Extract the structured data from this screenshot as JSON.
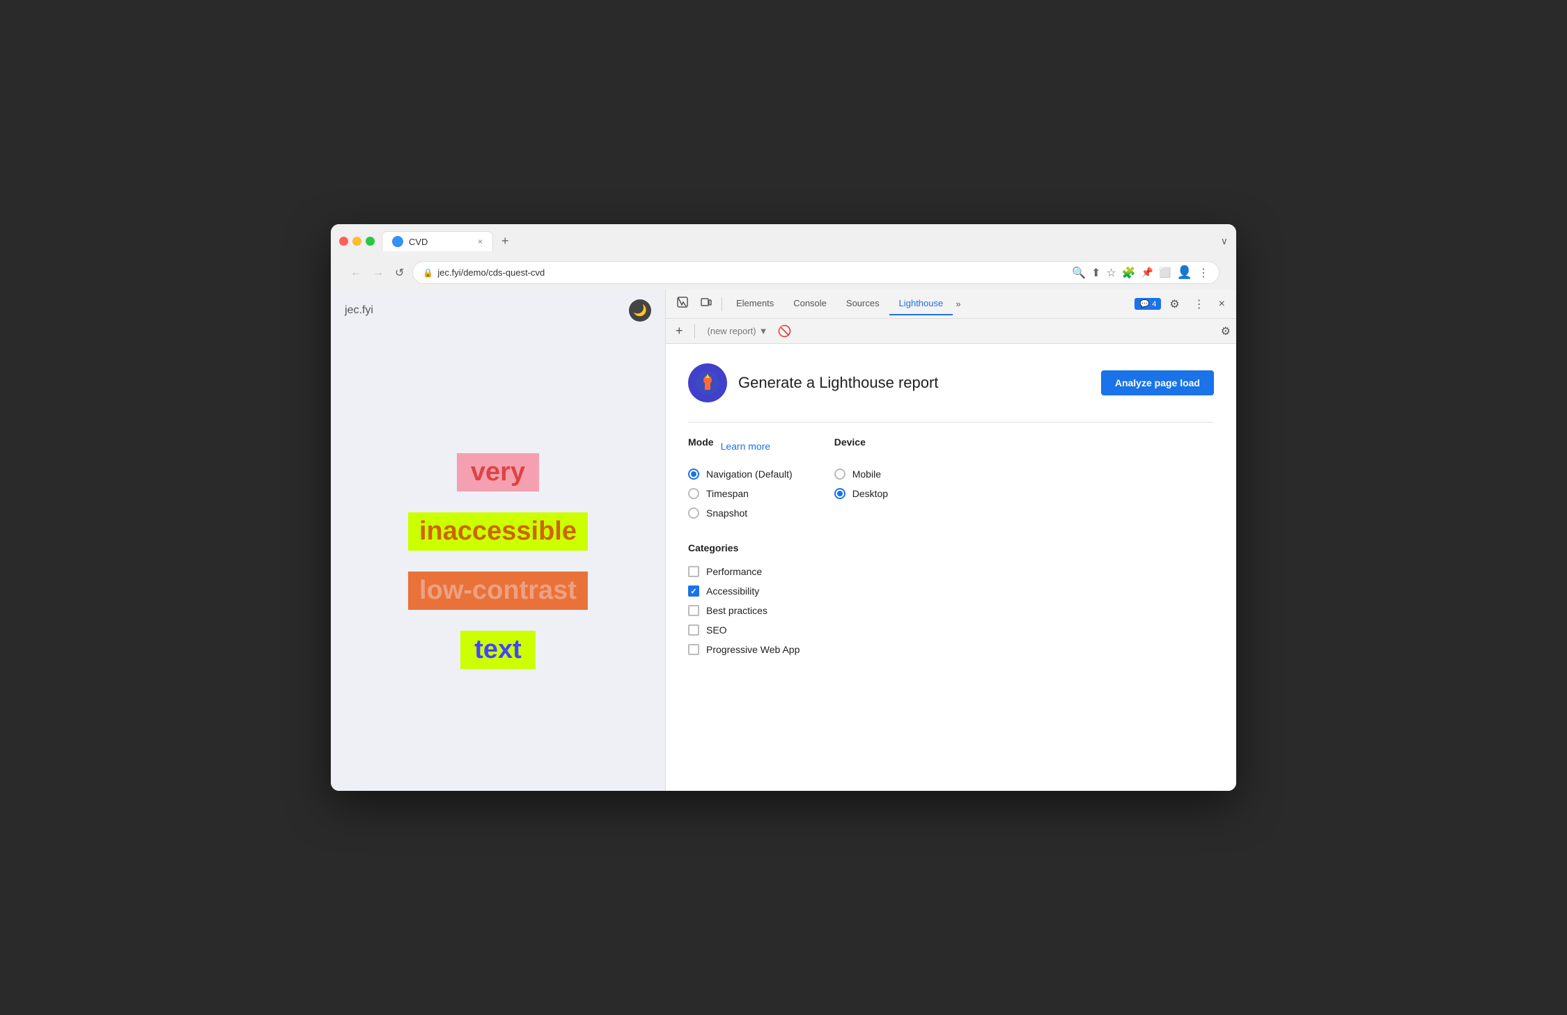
{
  "browser": {
    "tab_label": "CVD",
    "tab_close": "×",
    "tab_new": "+",
    "tab_more": "∨",
    "url": "jec.fyi/demo/cds-quest-cvd",
    "nav_back": "←",
    "nav_forward": "→",
    "nav_refresh": "↺"
  },
  "webpage": {
    "logo": "jec.fyi",
    "dark_mode_icon": "🌙",
    "words": [
      {
        "text": "very",
        "class": "text-very"
      },
      {
        "text": "inaccessible",
        "class": "text-inaccessible"
      },
      {
        "text": "low-contrast",
        "class": "text-lowcontrast"
      },
      {
        "text": "text",
        "class": "text-text"
      }
    ]
  },
  "devtools": {
    "tabs": [
      {
        "label": "Elements",
        "active": false
      },
      {
        "label": "Console",
        "active": false
      },
      {
        "label": "Sources",
        "active": false
      },
      {
        "label": "Lighthouse",
        "active": true
      }
    ],
    "more_tabs": "»",
    "badge_count": "4",
    "new_report_placeholder": "(new report)",
    "analyze_button": "Analyze page load",
    "generate_title": "Generate a Lighthouse report",
    "mode_label": "Mode",
    "learn_more": "Learn more",
    "device_label": "Device",
    "mode_options": [
      {
        "label": "Navigation (Default)",
        "selected": true
      },
      {
        "label": "Timespan",
        "selected": false
      },
      {
        "label": "Snapshot",
        "selected": false
      }
    ],
    "device_options": [
      {
        "label": "Mobile",
        "selected": false
      },
      {
        "label": "Desktop",
        "selected": true
      }
    ],
    "categories_label": "Categories",
    "categories": [
      {
        "label": "Performance",
        "checked": false
      },
      {
        "label": "Accessibility",
        "checked": true
      },
      {
        "label": "Best practices",
        "checked": false
      },
      {
        "label": "SEO",
        "checked": false
      },
      {
        "label": "Progressive Web App",
        "checked": false
      }
    ],
    "settings_icon": "⚙",
    "close_icon": "×",
    "more_icon": "⋮"
  }
}
